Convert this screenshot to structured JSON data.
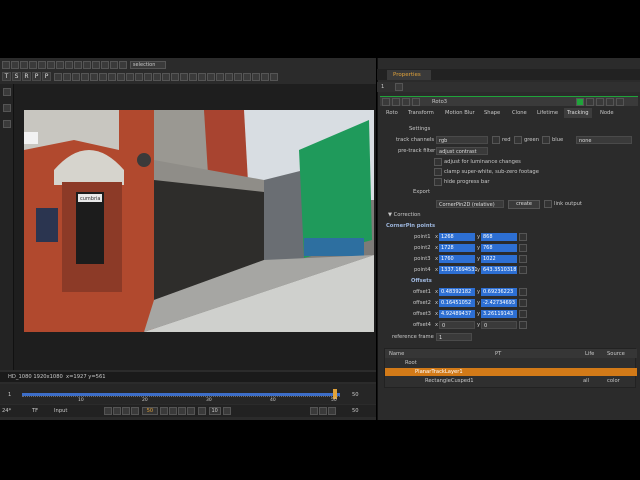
{
  "viewer": {
    "tb_letters": [
      "T",
      "S",
      "R",
      "P",
      "P"
    ],
    "selection": "selection",
    "format_line": "HD_1080 1920x1080",
    "coords": "x=1927 y=561",
    "frame_start": "1",
    "frame_end": "50",
    "frame_end2": "50",
    "ruler": [
      "10",
      "20",
      "30",
      "40",
      "50"
    ],
    "fps": "24*",
    "tf": "TF",
    "input": "Input",
    "current_frame": "50",
    "step": "10",
    "end_field": "50",
    "sign_text": "cumbria",
    "colors": {
      "red": "#b1492e",
      "green": "#1f9a5b",
      "sky": "#d8dde2"
    }
  },
  "props": {
    "title": "Properties",
    "count": "1",
    "node_name": "Roto3",
    "tabs": [
      "Roto",
      "Transform",
      "Motion Blur",
      "Shape",
      "Clone",
      "Lifetime",
      "Tracking",
      "Node"
    ],
    "active_tab": "Tracking",
    "settings": "Settings",
    "track_channels_label": "track channels",
    "track_channels_value": "rgb",
    "chk_red": "red",
    "chk_green": "green",
    "chk_blue": "blue",
    "none_value": "none",
    "pretrack_label": "pre-track filter",
    "pretrack_value": "adjust contrast",
    "opt1": "adjust for luminance changes",
    "opt2": "clamp super-white, sub-zero footage",
    "opt3": "hide progress bar",
    "export": "Export",
    "export_value": "CornerPin2D (relative)",
    "create": "create",
    "link_output": "link output",
    "correction": "Correction",
    "cornerpin": "CornerPin points",
    "points": [
      {
        "label": "point1",
        "x": "1268",
        "y": "868"
      },
      {
        "label": "point2",
        "x": "1728",
        "y": "768"
      },
      {
        "label": "point3",
        "x": "1760",
        "y": "1022"
      },
      {
        "label": "point4",
        "x": "1337.1694531",
        "y": "643.3510318"
      }
    ],
    "offsets_label": "Offsets",
    "offsets": [
      {
        "label": "offset1",
        "x": "0.48392182",
        "y": "0.69236223"
      },
      {
        "label": "offset2",
        "x": "0.16451052",
        "y": "-2.42734693"
      },
      {
        "label": "offset3",
        "x": "4.92489437",
        "y": "3.26119143"
      },
      {
        "label": "offset4",
        "x": "0",
        "y": "0"
      }
    ],
    "ref_label": "reference frame",
    "ref_value": "1",
    "tree_headers": {
      "name": "Name",
      "pt": "PT",
      "life": "Life",
      "source": "Source"
    },
    "tree": [
      {
        "name": "Root",
        "life": "",
        "source": ""
      },
      {
        "name": "PlanarTrackLayer1",
        "life": "",
        "source": ""
      },
      {
        "name": "RectangleCusped1",
        "life": "all",
        "source": "color"
      }
    ]
  }
}
